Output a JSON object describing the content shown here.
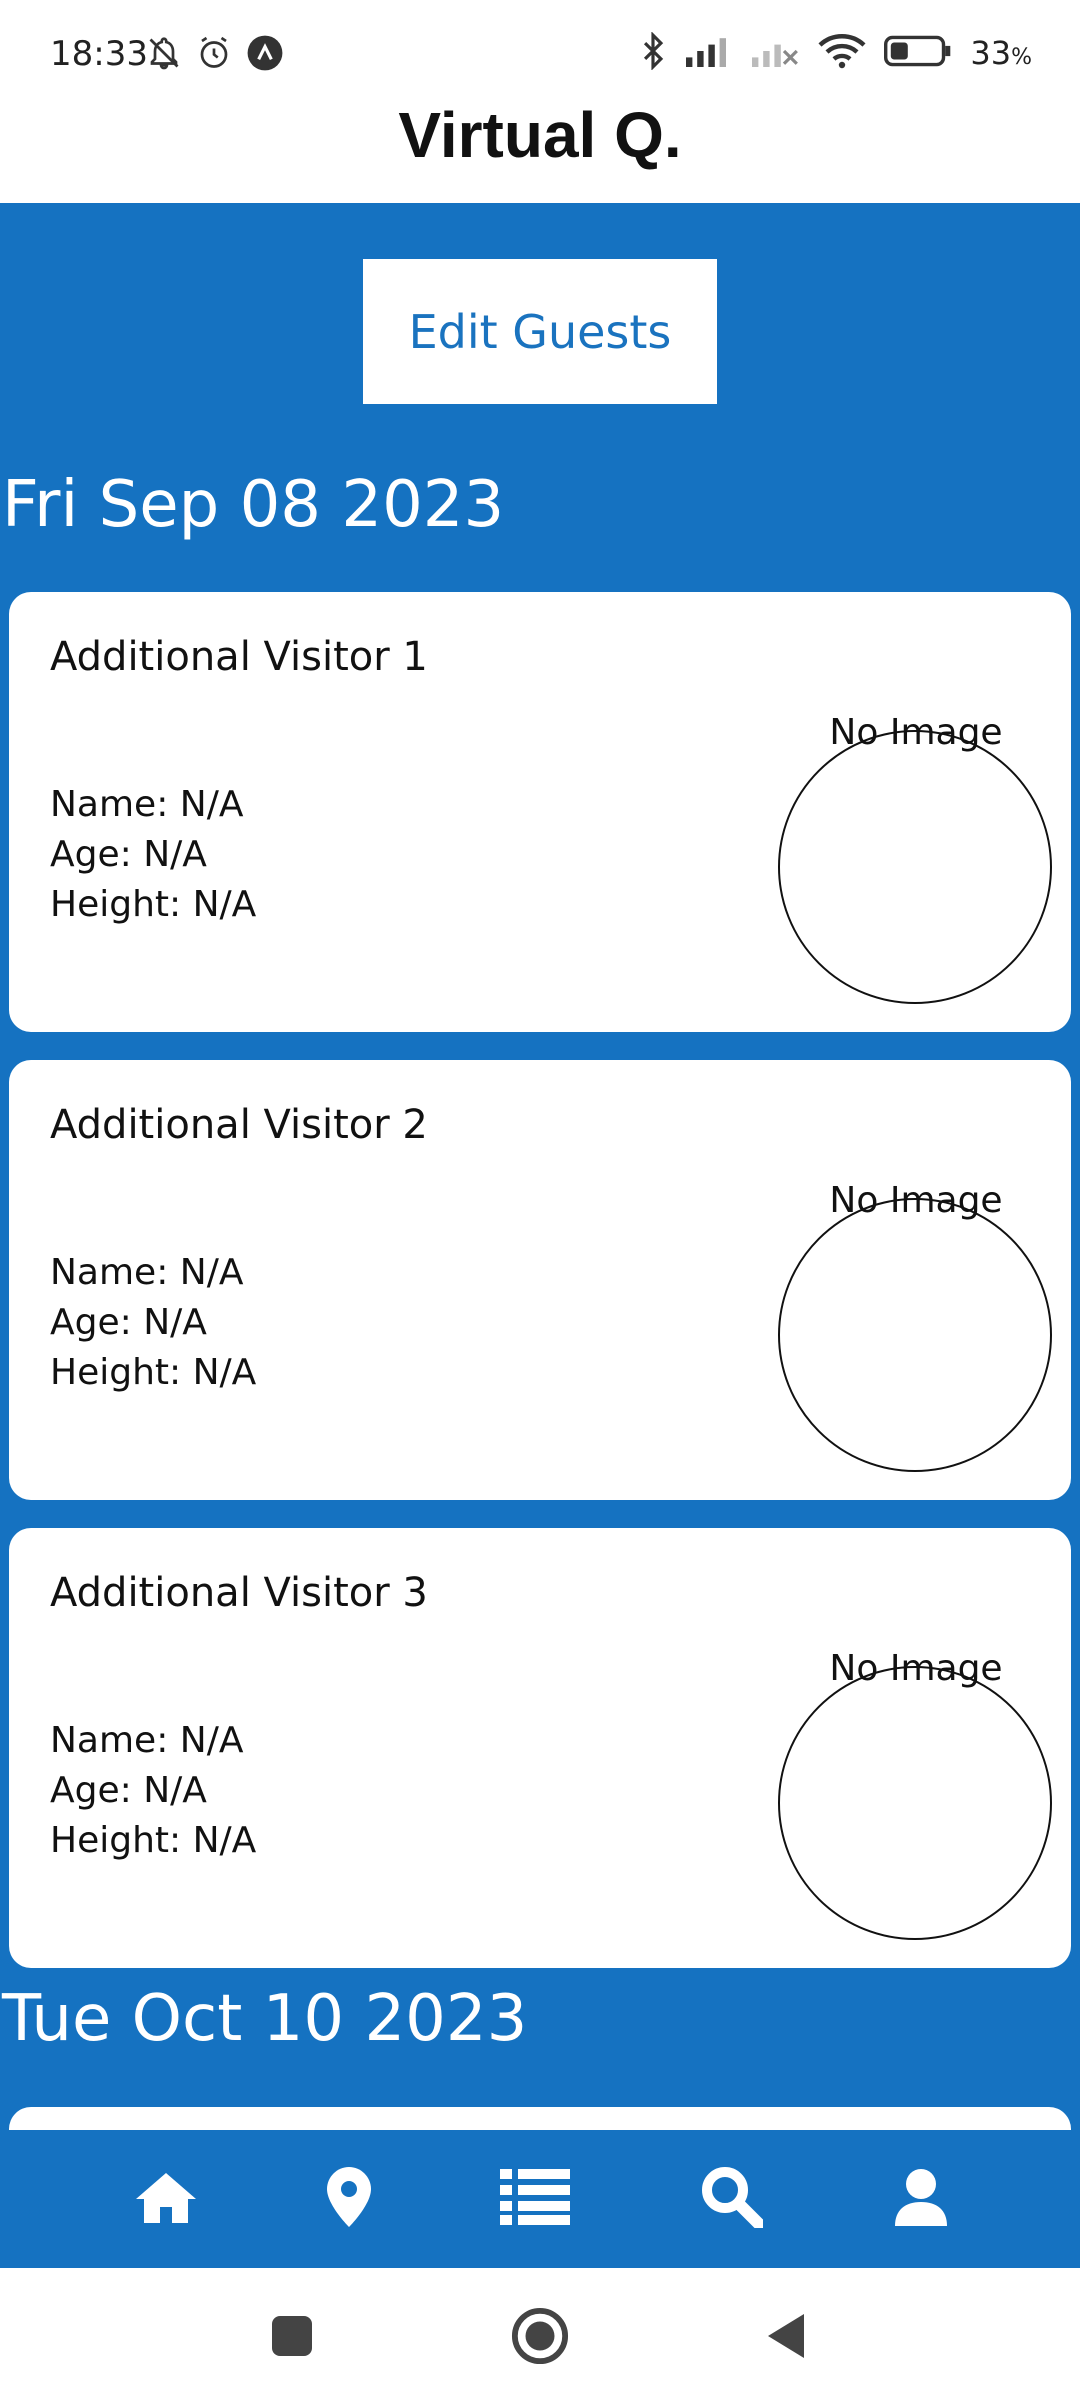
{
  "status_bar": {
    "time": "18:33",
    "battery_percent": "33",
    "battery_unit": "%",
    "left_icons": [
      "bell-off-icon",
      "alarm-icon",
      "app-notification-icon"
    ],
    "right_icons": [
      "bluetooth-icon",
      "signal-icon",
      "signal-disabled-icon",
      "wifi-icon",
      "battery-icon"
    ]
  },
  "app_bar": {
    "title": "Virtual Q."
  },
  "main": {
    "edit_button_label": "Edit Guests",
    "date_groups": [
      {
        "date": "Fri Sep 08 2023",
        "visitors": [
          {
            "title": "Additional Visitor 1",
            "name": "Name: N/A",
            "age": "Age: N/A",
            "height": "Height: N/A",
            "image_placeholder": "No Image"
          },
          {
            "title": "Additional Visitor 2",
            "name": "Name: N/A",
            "age": "Age: N/A",
            "height": "Height: N/A",
            "image_placeholder": "No Image"
          },
          {
            "title": "Additional Visitor 3",
            "name": "Name: N/A",
            "age": "Age: N/A",
            "height": "Height: N/A",
            "image_placeholder": "No Image"
          }
        ]
      },
      {
        "date": "Tue Oct 10 2023",
        "visitors": []
      }
    ]
  },
  "bottom_nav": {
    "items": [
      "home-icon",
      "location-pin-icon",
      "list-icon",
      "search-icon",
      "profile-icon"
    ]
  },
  "system_nav": {
    "items": [
      "recents-button",
      "home-button",
      "back-button"
    ]
  },
  "colors": {
    "primary": "#1572C1",
    "surface": "#FFFFFF",
    "text": "#111111"
  }
}
